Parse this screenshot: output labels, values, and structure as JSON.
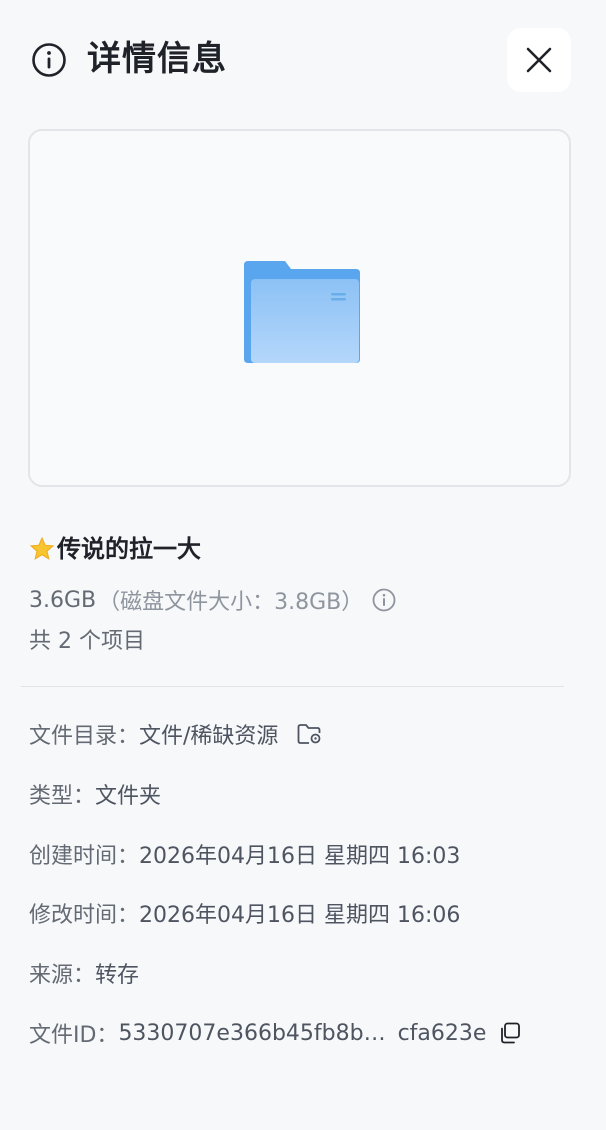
{
  "header": {
    "title": "详情信息"
  },
  "file": {
    "name": "传说的拉一大",
    "size": "3.6GB",
    "disk_size_text": "（磁盘文件大小：3.8GB）",
    "item_count_text": "共 2 个项目"
  },
  "details": {
    "directory": {
      "label": "文件目录：",
      "value": "文件/稀缺资源"
    },
    "type": {
      "label": "类型：",
      "value": "文件夹"
    },
    "created": {
      "label": "创建时间：",
      "value": "2026年04月16日 星期四 16:03"
    },
    "modified": {
      "label": "修改时间：",
      "value": "2026年04月16日 星期四 16:06"
    },
    "source": {
      "label": "来源：",
      "value": "转存"
    },
    "file_id": {
      "label": "文件ID：",
      "value_head": "5330707e366b45fb8b…",
      "value_tail": "cfa623e"
    }
  },
  "icons": {
    "header": "info-icon",
    "close": "close-icon",
    "preview": "folder-icon",
    "name_prefix": "star-icon",
    "size_info": "info-icon",
    "directory": "folder-location-icon",
    "copy": "copy-icon"
  },
  "colors": {
    "folder_back": "#5aa6ee",
    "folder_front": "#8fc3f7",
    "text_primary": "#1f2329",
    "text_secondary": "#646a73"
  }
}
